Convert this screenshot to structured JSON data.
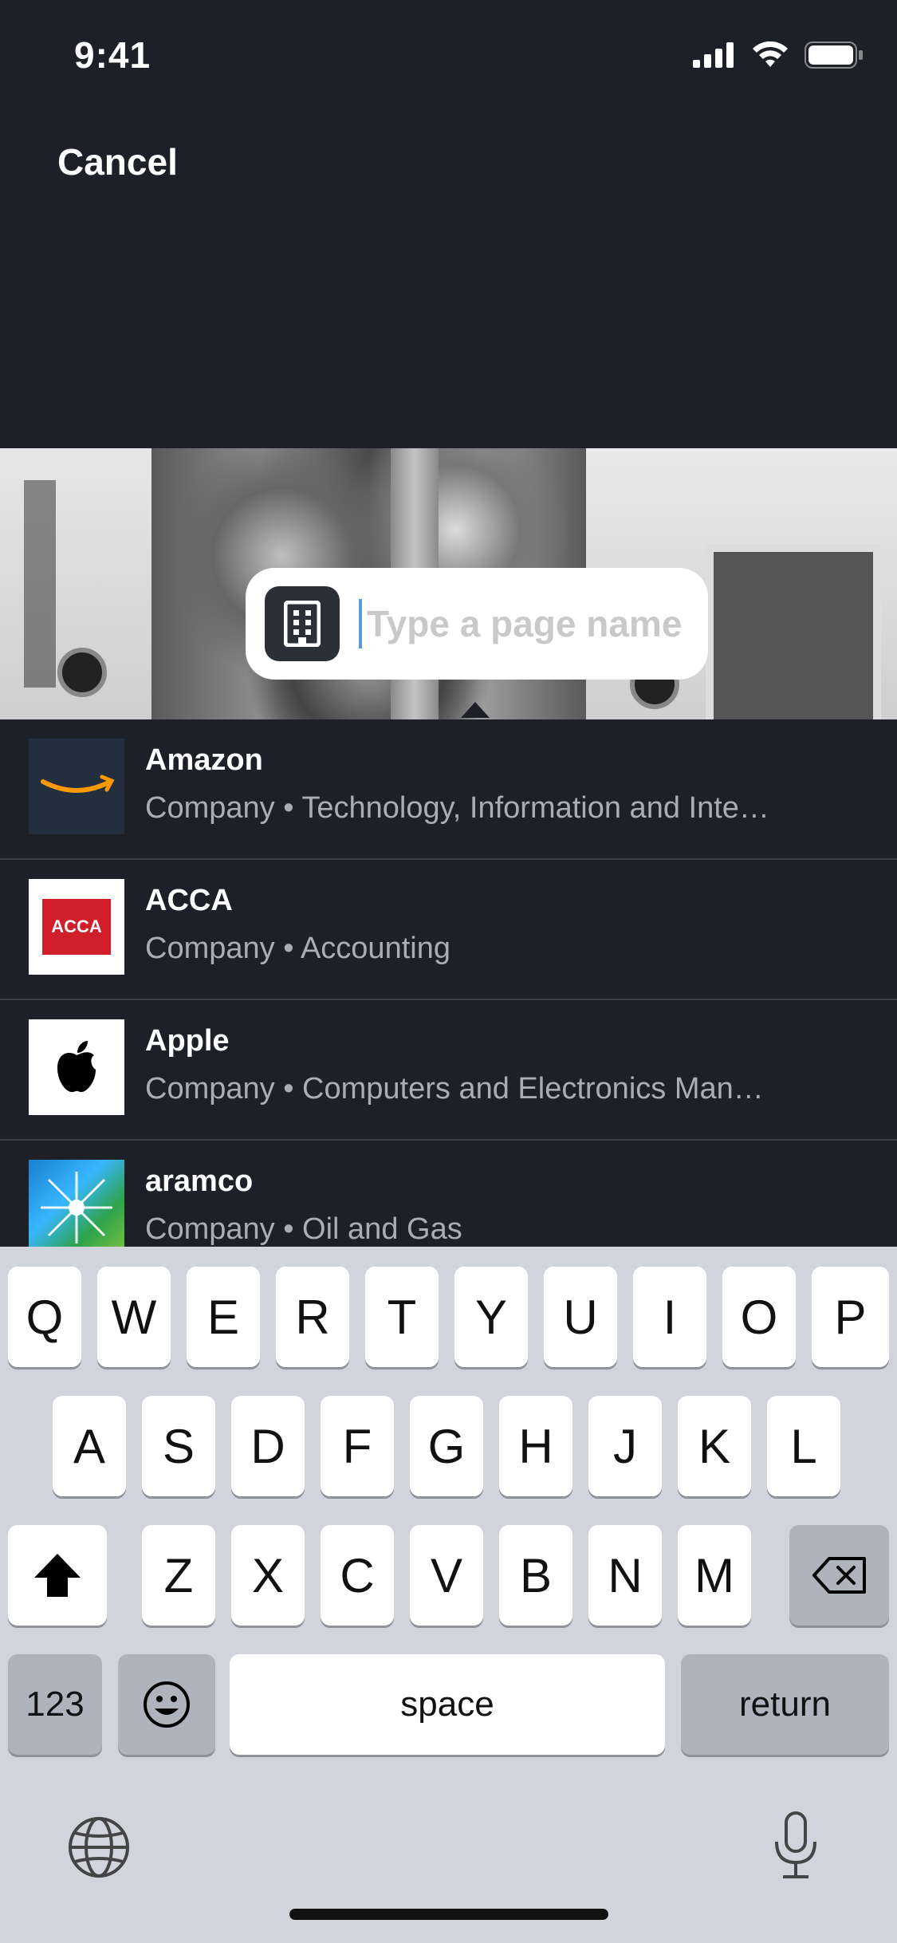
{
  "status_bar": {
    "time": "9:41"
  },
  "header": {
    "cancel_label": "Cancel"
  },
  "search": {
    "placeholder": "Type a page name"
  },
  "results": [
    {
      "name": "Amazon",
      "subtitle": "Company • Technology, Information and Inte…",
      "logo": "amazon-logo"
    },
    {
      "name": "ACCA",
      "subtitle": "Company • Accounting",
      "logo_text": "ACCA"
    },
    {
      "name": "Apple",
      "subtitle": "Company • Computers and Electronics Man…",
      "logo": "apple-logo"
    },
    {
      "name": "aramco",
      "subtitle": "Company • Oil and Gas",
      "logo": "aramco-logo"
    }
  ],
  "keyboard": {
    "row1": [
      "Q",
      "W",
      "E",
      "R",
      "T",
      "Y",
      "U",
      "I",
      "O",
      "P"
    ],
    "row2": [
      "A",
      "S",
      "D",
      "F",
      "G",
      "H",
      "J",
      "K",
      "L"
    ],
    "row3": [
      "Z",
      "X",
      "C",
      "V",
      "B",
      "N",
      "M"
    ],
    "numbers_label": "123",
    "space_label": "space",
    "return_label": "return"
  },
  "colors": {
    "background": "#1d2026",
    "keyboard_bg": "#d1d4da",
    "accent": "#5b9bd5"
  }
}
